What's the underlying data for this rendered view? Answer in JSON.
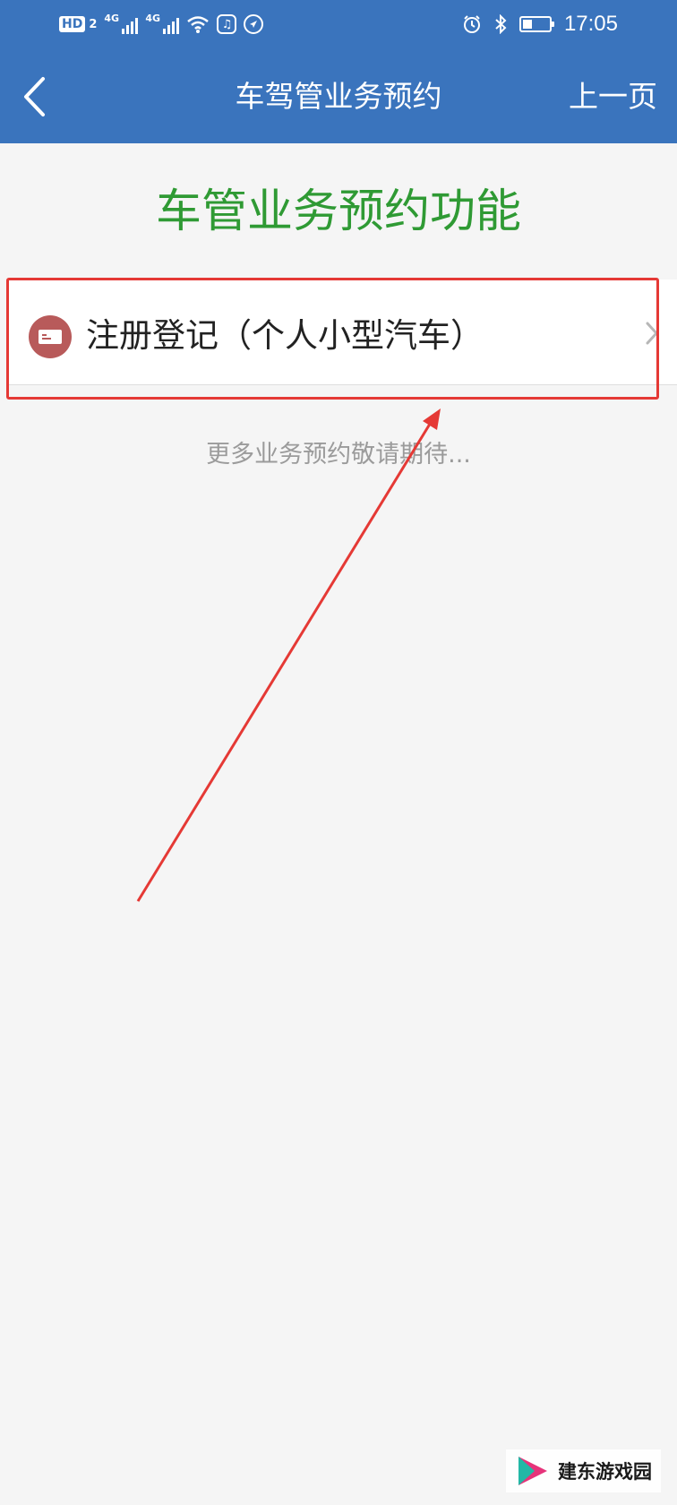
{
  "status_bar": {
    "hd_label": "HD",
    "sim_number": "2",
    "network_1": "4G",
    "network_2": "4G",
    "time": "17:05",
    "icons": [
      "signal-icon",
      "signal-icon",
      "wifi-icon",
      "music-app-icon",
      "browser-app-icon",
      "alarm-icon",
      "bluetooth-icon",
      "battery-icon"
    ]
  },
  "nav": {
    "title": "车驾管业务预约",
    "prev_page": "上一页",
    "back_icon": "chevron-left-icon"
  },
  "main": {
    "section_title": "车管业务预约功能",
    "services": [
      {
        "label": "注册登记（个人小型汽车）",
        "icon": "id-card-icon",
        "icon_color": "#b85a5a"
      }
    ],
    "more_text": "更多业务预约敬请期待..."
  },
  "annotation": {
    "highlight_color": "#e53935"
  },
  "watermark": {
    "text": "建东游戏园"
  },
  "colors": {
    "header": "#3a74bd",
    "title_green": "#2f9a34",
    "background": "#f5f5f5"
  }
}
